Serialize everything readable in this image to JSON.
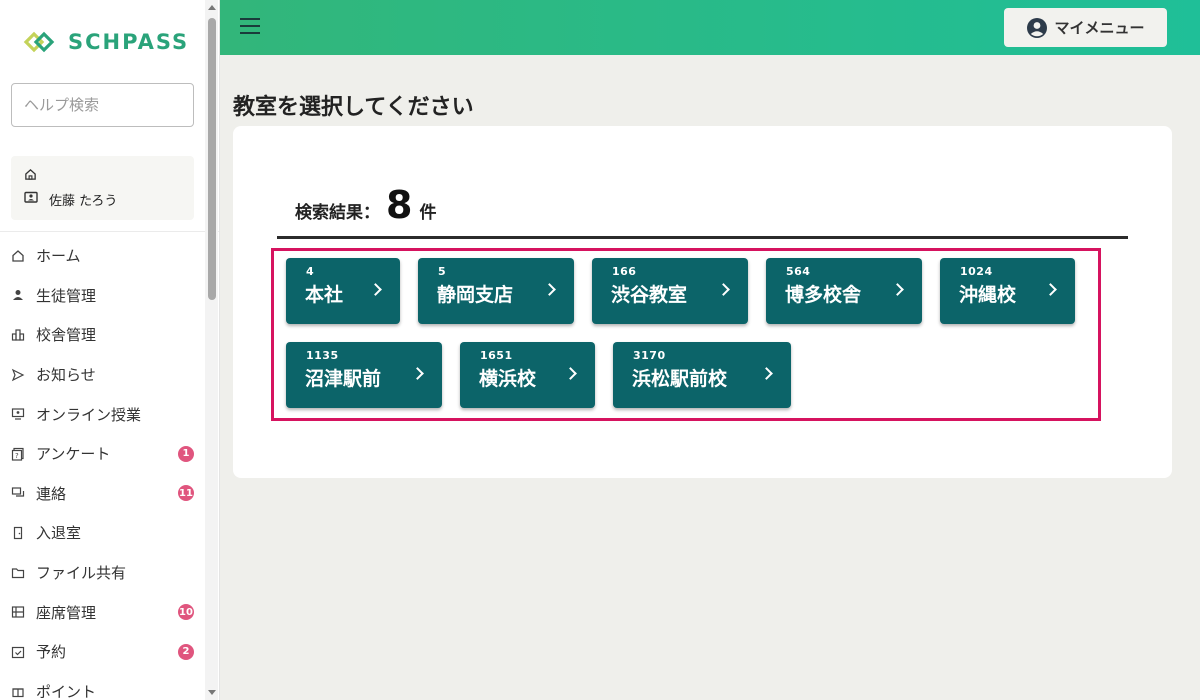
{
  "brand": {
    "name": "SCHPASS",
    "color": "#2aa37a"
  },
  "sidebar": {
    "help_search_placeholder": "ヘルプ検索",
    "user": {
      "name": "佐藤 たろう"
    },
    "items": [
      {
        "label": "ホーム",
        "icon": "home-icon",
        "badge": ""
      },
      {
        "label": "生徒管理",
        "icon": "student-icon",
        "badge": ""
      },
      {
        "label": "校舎管理",
        "icon": "building-icon",
        "badge": ""
      },
      {
        "label": "お知らせ",
        "icon": "send-icon",
        "badge": ""
      },
      {
        "label": "オンライン授業",
        "icon": "monitor-icon",
        "badge": ""
      },
      {
        "label": "アンケート",
        "icon": "survey-icon",
        "badge": "1"
      },
      {
        "label": "連絡",
        "icon": "chat-icon",
        "badge": "11"
      },
      {
        "label": "入退室",
        "icon": "door-icon",
        "badge": ""
      },
      {
        "label": "ファイル共有",
        "icon": "folder-icon",
        "badge": ""
      },
      {
        "label": "座席管理",
        "icon": "seat-icon",
        "badge": "10"
      },
      {
        "label": "予約",
        "icon": "calendar-icon",
        "badge": "2"
      },
      {
        "label": "ポイント",
        "icon": "gift-icon",
        "badge": ""
      }
    ],
    "badge_color": "#e0557e"
  },
  "header": {
    "mymenu_label": "マイメニュー",
    "gradient_start": "#32b67a",
    "gradient_end": "#1fbf98"
  },
  "main": {
    "title": "教室を選択してください",
    "result_label": "検索結果：",
    "result_count": "8",
    "result_unit": "件",
    "classrooms": [
      {
        "code": "4",
        "name": "本社"
      },
      {
        "code": "5",
        "name": "静岡支店"
      },
      {
        "code": "166",
        "name": "渋谷教室"
      },
      {
        "code": "564",
        "name": "博多校舎"
      },
      {
        "code": "1024",
        "name": "沖縄校"
      },
      {
        "code": "1135",
        "name": "沼津駅前"
      },
      {
        "code": "1651",
        "name": "横浜校"
      },
      {
        "code": "3170",
        "name": "浜松駅前校"
      }
    ],
    "button_color": "#0c6469",
    "highlight_color": "#d6135f"
  }
}
